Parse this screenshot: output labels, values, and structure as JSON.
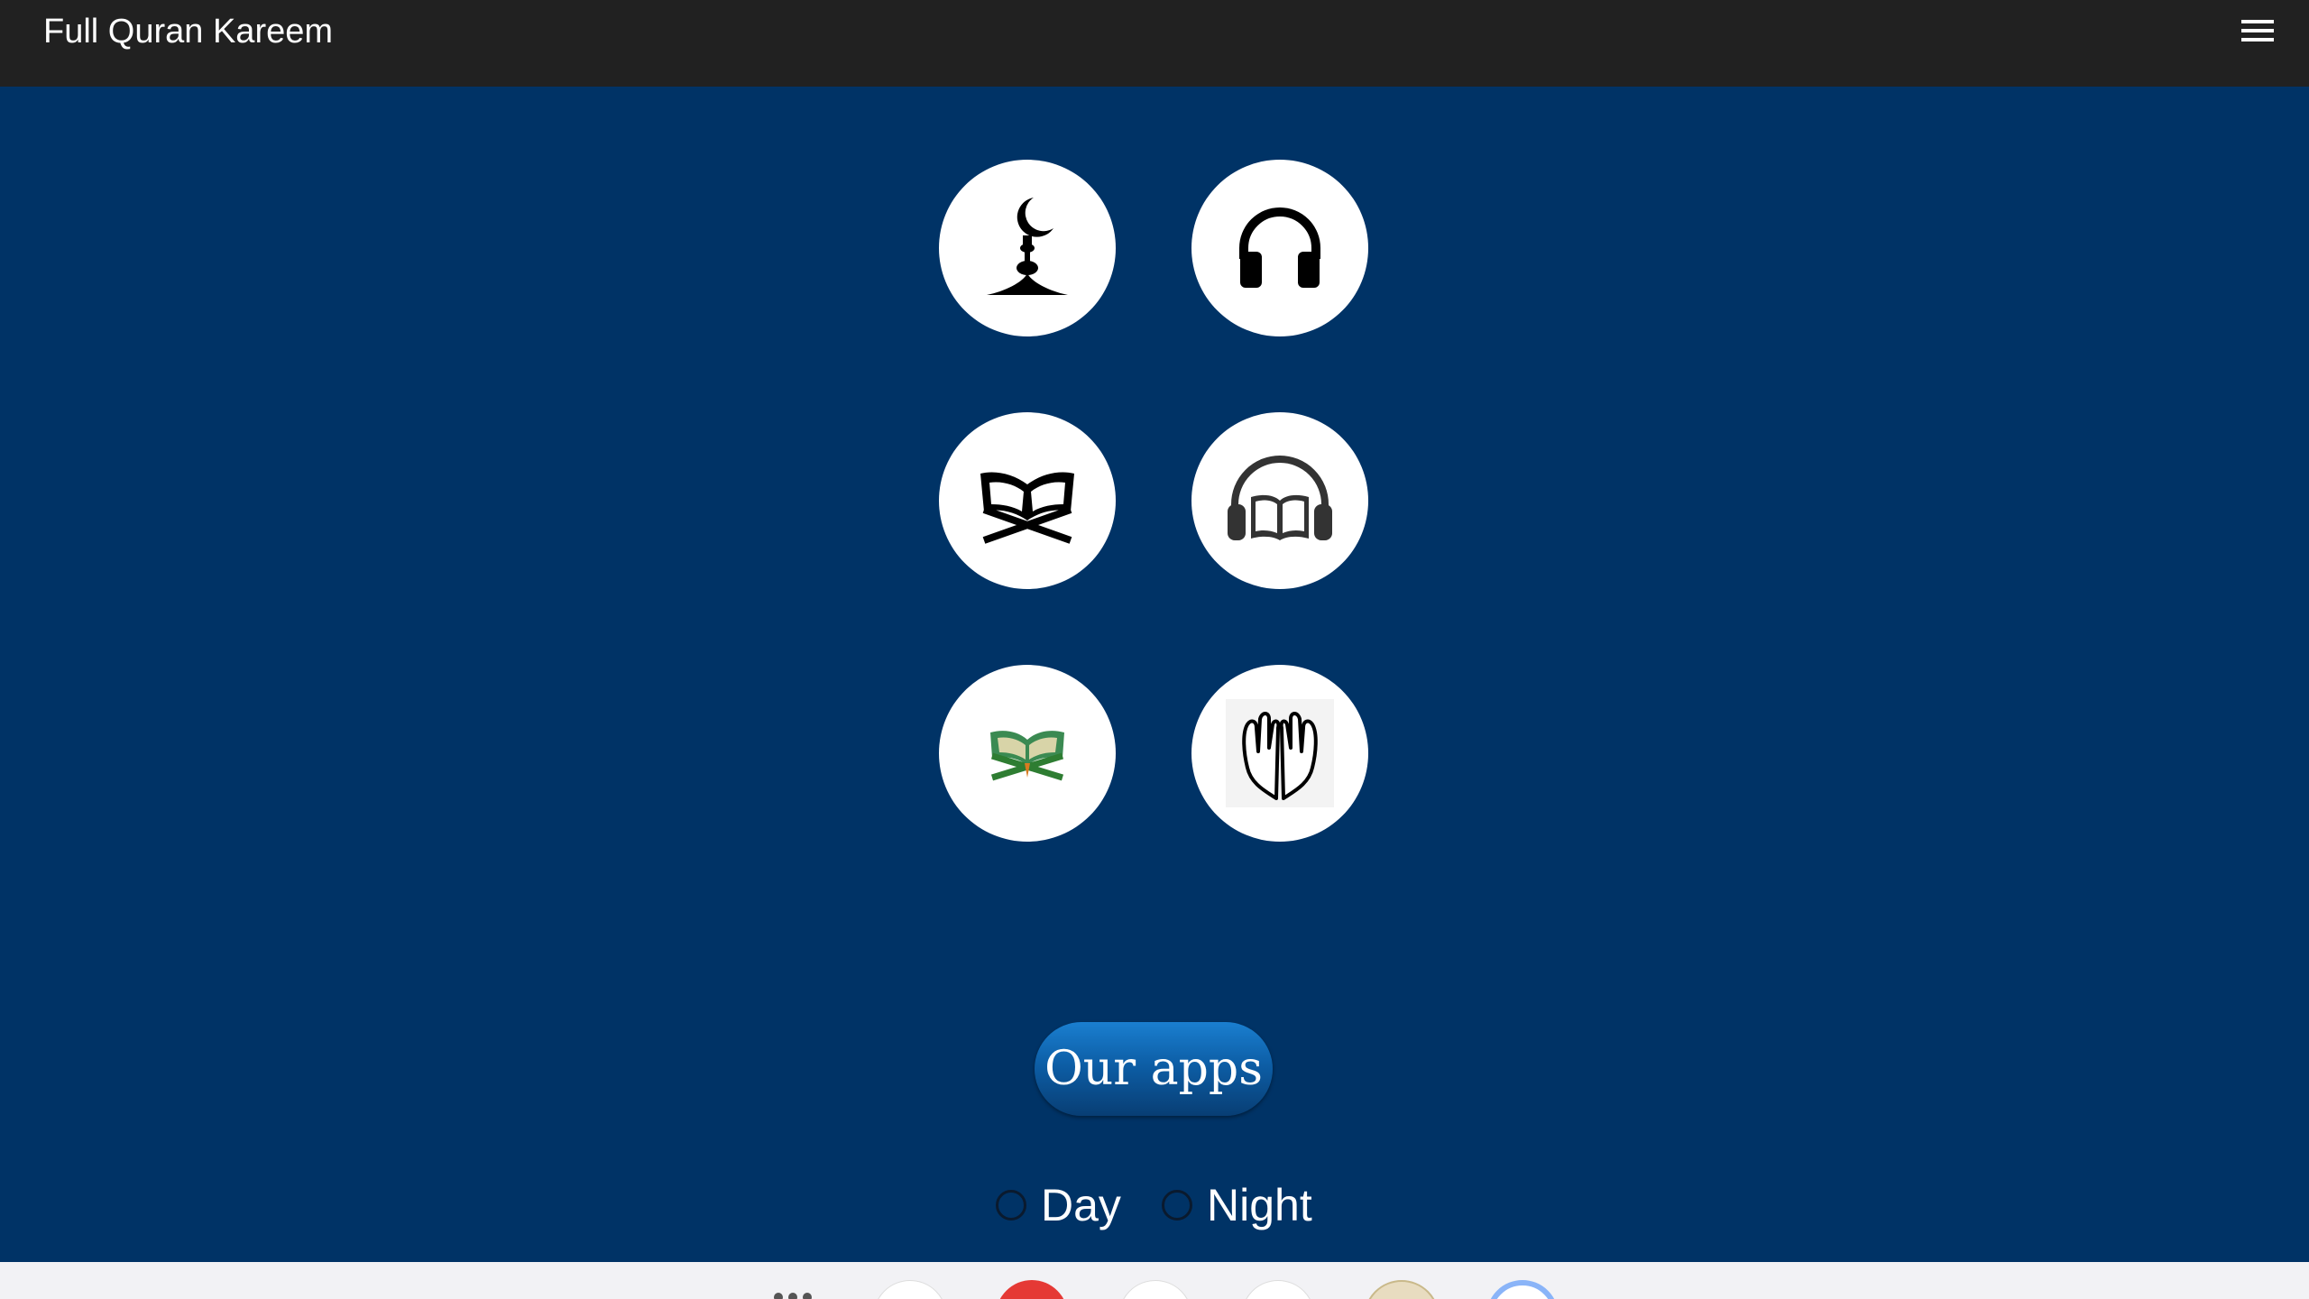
{
  "app": {
    "title": "Full Quran Kareem"
  },
  "header": {
    "menu_icon": "hamburger-menu-icon"
  },
  "grid": {
    "buttons": [
      {
        "icon": "mosque-crescent-icon"
      },
      {
        "icon": "headphones-icon"
      },
      {
        "icon": "quran-book-stand-icon"
      },
      {
        "icon": "audio-book-icon"
      },
      {
        "icon": "colored-quran-icon"
      },
      {
        "icon": "praying-hands-icon"
      }
    ]
  },
  "our_apps": {
    "label": "Our apps"
  },
  "theme": {
    "day_label": "Day",
    "night_label": "Night"
  },
  "colors": {
    "header_bg": "#212121",
    "main_bg": "#003366",
    "button_bg": "#ffffff",
    "accent": "#0d5ea6"
  }
}
